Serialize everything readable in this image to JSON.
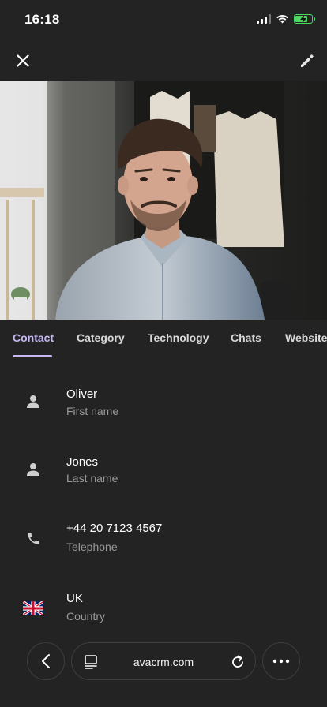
{
  "status_bar": {
    "time": "16:18",
    "icons": [
      "signal-icon",
      "wifi-icon",
      "battery-charging-icon"
    ],
    "battery_color": "#4cd964"
  },
  "top_bar": {
    "left_icon": "close-icon",
    "right_icon": "edit-pencil-icon"
  },
  "photo": {
    "subject": "profile-photo"
  },
  "tabs": [
    {
      "label": "Contact",
      "active": true
    },
    {
      "label": "Category",
      "active": false
    },
    {
      "label": "Technology",
      "active": false
    },
    {
      "label": "Chats",
      "active": false
    },
    {
      "label": "Website",
      "active": false
    }
  ],
  "accent_color": "#c7b8f5",
  "fields": [
    {
      "icon": "person-icon",
      "value": "Oliver",
      "label": "First name"
    },
    {
      "icon": "person-icon",
      "value": "Jones",
      "label": "Last name"
    },
    {
      "icon": "phone-icon",
      "value": "+44 20 7123 4567",
      "label": "Telephone"
    },
    {
      "icon": "uk-flag-icon",
      "value": "UK",
      "label": "Country"
    }
  ],
  "browser_bar": {
    "url": "avacrm.com",
    "icons": [
      "back-icon",
      "tabs-icon",
      "reload-icon",
      "more-icon"
    ]
  }
}
